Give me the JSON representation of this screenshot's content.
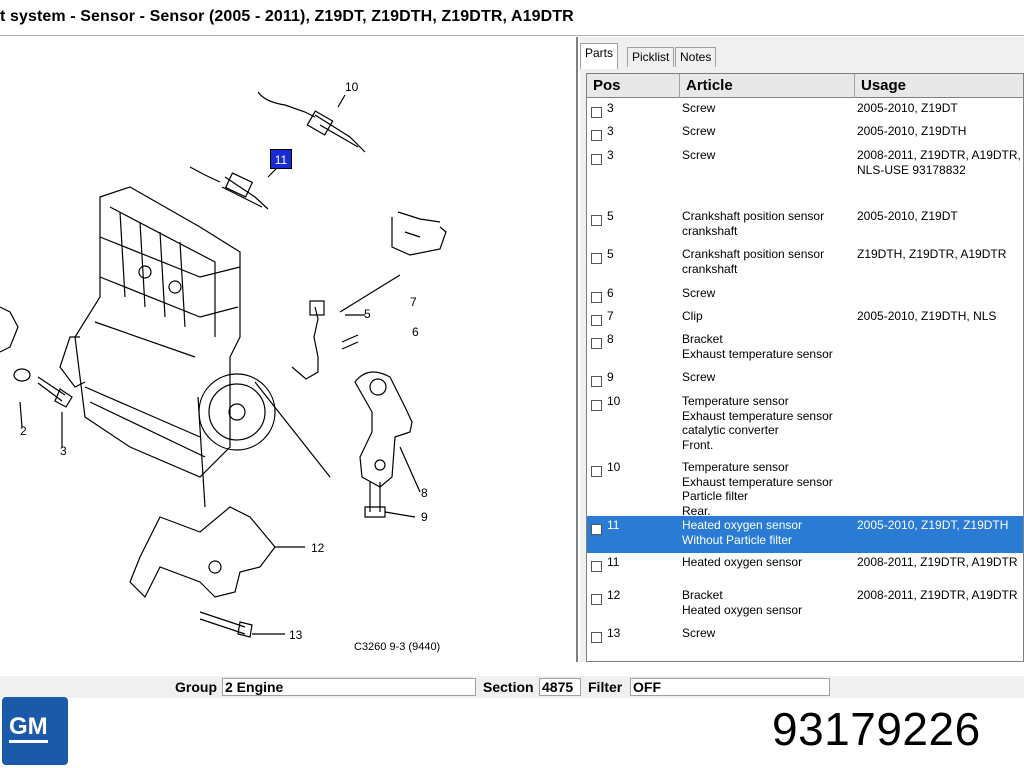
{
  "window": {
    "title": "t system - Sensor - Sensor   (2005 - 2011), Z19DT, Z19DTH, Z19DTR, A19DTR"
  },
  "diagram": {
    "callouts": [
      "10",
      "11",
      "7",
      "5",
      "6",
      "2",
      "3",
      "8",
      "9",
      "12",
      "13"
    ],
    "highlighted": "11",
    "reference": "C3260 9-3 (9440)"
  },
  "tabs": [
    {
      "label": "Parts"
    },
    {
      "label": "Picklist"
    },
    {
      "label": "Notes"
    }
  ],
  "parts_table": {
    "headers": {
      "pos": "Pos",
      "article": "Article",
      "usage": "Usage"
    },
    "rows": [
      {
        "pos": "3",
        "article": "Screw",
        "usage": "2005-2010, Z19DT"
      },
      {
        "pos": "3",
        "article": "Screw",
        "usage": "2005-2010, Z19DTH"
      },
      {
        "pos": "3",
        "article": "Screw",
        "usage": "2008-2011, Z19DTR, A19DTR, NLS-USE 93178832"
      },
      {
        "pos": "5",
        "article": "Crankshaft position sensor crankshaft",
        "usage": "2005-2010, Z19DT"
      },
      {
        "pos": "5",
        "article": "Crankshaft position sensor crankshaft",
        "usage": "Z19DTH, Z19DTR, A19DTR"
      },
      {
        "pos": "6",
        "article": "Screw",
        "usage": ""
      },
      {
        "pos": "7",
        "article": "Clip",
        "usage": "2005-2010, Z19DTH, NLS"
      },
      {
        "pos": "8",
        "article": "Bracket\nExhaust temperature sensor",
        "usage": ""
      },
      {
        "pos": "9",
        "article": "Screw",
        "usage": ""
      },
      {
        "pos": "10",
        "article": "Temperature sensor\nExhaust temperature sensor\ncatalytic converter\nFront.",
        "usage": ""
      },
      {
        "pos": "10",
        "article": "Temperature sensor\nExhaust temperature sensor\nParticle filter\nRear.",
        "usage": ""
      },
      {
        "pos": "11",
        "article": "Heated oxygen sensor\nWithout  Particle filter",
        "usage": "2005-2010, Z19DT, Z19DTH",
        "selected": true
      },
      {
        "pos": "11",
        "article": "Heated oxygen sensor",
        "usage": "2008-2011, Z19DTR, A19DTR"
      },
      {
        "pos": "12",
        "article": "Bracket\nHeated oxygen sensor",
        "usage": "2008-2011, Z19DTR, A19DTR"
      },
      {
        "pos": "13",
        "article": "Screw",
        "usage": ""
      }
    ]
  },
  "statusbar": {
    "group_label": "Group",
    "group_value": "2 Engine",
    "section_label": "Section",
    "section_value": "4875",
    "filter_label": "Filter",
    "filter_value": "OFF"
  },
  "brand": {
    "logo_text": "GM",
    "color": "#1b5aa8"
  },
  "part_number": "93179226",
  "colors": {
    "selection": "#2a7bd3",
    "callout_highlight": "#1a2bd6"
  }
}
